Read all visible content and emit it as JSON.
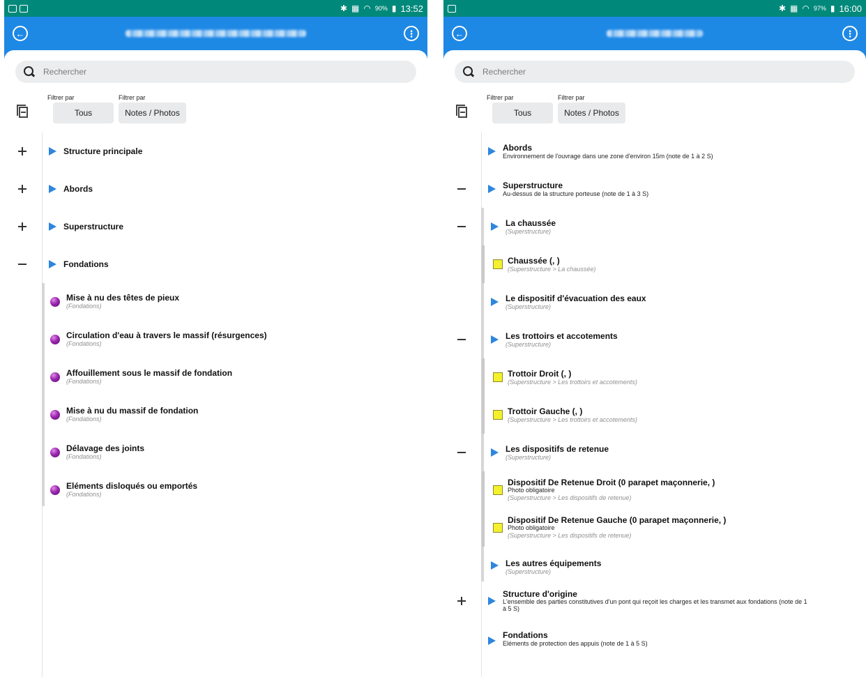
{
  "left": {
    "status": {
      "battery": "90%",
      "time": "13:52"
    },
    "search": {
      "placeholder": "Rechercher"
    },
    "filters": [
      {
        "label": "Filtrer par",
        "value": "Tous"
      },
      {
        "label": "Filtrer par",
        "value": "Notes / Photos"
      }
    ],
    "groups": [
      {
        "title": "Structure principale",
        "state": "collapsed"
      },
      {
        "title": "Abords",
        "state": "collapsed"
      },
      {
        "title": "Superstructure",
        "state": "collapsed"
      },
      {
        "title": "Fondations",
        "state": "expanded"
      }
    ],
    "items": [
      {
        "title": "Mise à nu des têtes de pieux",
        "path": "(Fondations)"
      },
      {
        "title": "Circulation d'eau à travers le massif (résurgences)",
        "path": "(Fondations)"
      },
      {
        "title": "Affouillement sous le massif de fondation",
        "path": "(Fondations)"
      },
      {
        "title": "Mise à nu du massif de fondation",
        "path": "(Fondations)"
      },
      {
        "title": "Délavage des joints",
        "path": "(Fondations)"
      },
      {
        "title": "Eléments disloqués ou emportés",
        "path": "(Fondations)"
      }
    ]
  },
  "right": {
    "status": {
      "battery": "97%",
      "time": "16:00"
    },
    "search": {
      "placeholder": "Rechercher"
    },
    "filters": [
      {
        "label": "Filtrer par",
        "value": "Tous"
      },
      {
        "label": "Filtrer par",
        "value": "Notes / Photos"
      }
    ],
    "rows": [
      {
        "title": "Abords",
        "sub": "Environnement de l'ouvrage dans une zone d'environ 15m (note de 1 à 2 S)"
      },
      {
        "title": "Superstructure",
        "sub": "Au-dessus de la structure porteuse (note de 1 à 3 S)"
      },
      {
        "title": "La chaussée",
        "path": "(Superstructure)"
      },
      {
        "title": "Chaussée (, )",
        "path": "(Superstructure > La chaussée)"
      },
      {
        "title": "Le dispositif d'évacuation des eaux",
        "path": "(Superstructure)"
      },
      {
        "title": "Les trottoirs et accotements",
        "path": "(Superstructure)"
      },
      {
        "title": "Trottoir Droit (, )",
        "path": "(Superstructure > Les trottoirs et accotements)"
      },
      {
        "title": "Trottoir Gauche (, )",
        "path": "(Superstructure > Les trottoirs et accotements)"
      },
      {
        "title": "Les dispositifs de retenue",
        "path": "(Superstructure)"
      },
      {
        "title": "Dispositif De Retenue Droit (0 parapet maçonnerie, )",
        "sub": "Photo obligatoire",
        "path": "(Superstructure > Les dispositifs de retenue)"
      },
      {
        "title": "Dispositif De Retenue Gauche (0 parapet maçonnerie, )",
        "sub": "Photo obligatoire",
        "path": "(Superstructure > Les dispositifs de retenue)"
      },
      {
        "title": "Les autres équipements",
        "path": "(Superstructure)"
      },
      {
        "title": "Structure d'origine",
        "sub": "L'ensemble des parties constitutives d'un pont qui reçoit les charges et les transmet aux fondations (note de 1",
        "sub2": "à 5 S)"
      },
      {
        "title": "Fondations",
        "sub": "Eléments de protection des appuis (note de 1 à 5 S)"
      }
    ]
  }
}
